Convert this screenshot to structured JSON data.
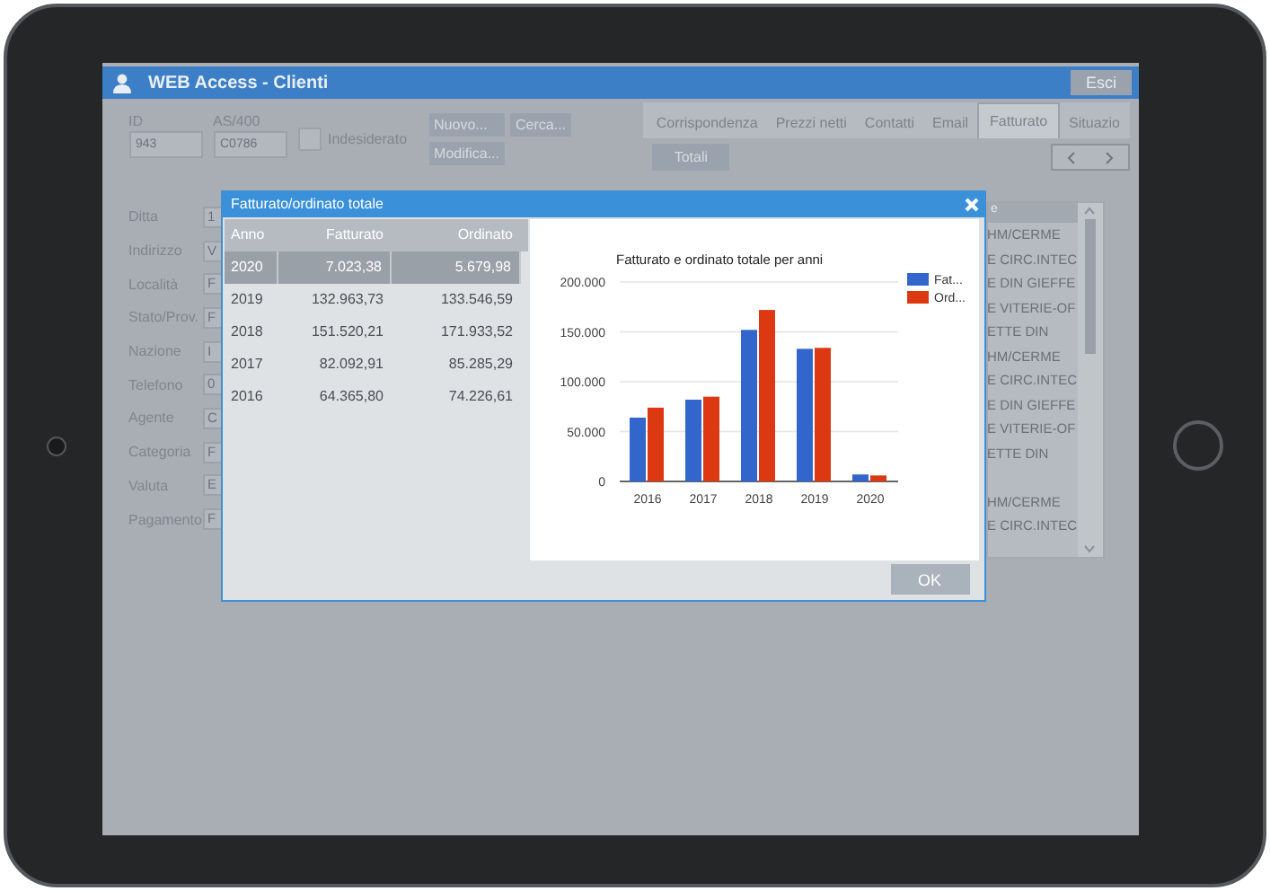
{
  "window": {
    "title": "WEB Access - Clienti",
    "exit_button": "Esci"
  },
  "header_fields": [
    {
      "label": "ID",
      "value": "943"
    },
    {
      "label": "AS/400",
      "value": "C0786"
    }
  ],
  "undesired_checkbox": {
    "label": "Indesiderato",
    "checked": false
  },
  "action_buttons": [
    "Nuovo...",
    "Cerca...",
    "Modifica..."
  ],
  "tabs": [
    {
      "label": "Corrispondenza",
      "selected": false
    },
    {
      "label": "Prezzi netti",
      "selected": false
    },
    {
      "label": "Contatti",
      "selected": false
    },
    {
      "label": "Email",
      "selected": false
    },
    {
      "label": "Fatturato",
      "selected": true
    },
    {
      "label": "Situazio",
      "selected": false
    }
  ],
  "totals_button": "Totali",
  "form_fields": [
    {
      "label": "Ditta",
      "value": "1"
    },
    {
      "label": "Indirizzo",
      "value": "V"
    },
    {
      "label": "Località",
      "value": "F"
    },
    {
      "label": "Stato/Prov.",
      "value": "F"
    },
    {
      "label": "Nazione",
      "value": "I"
    },
    {
      "label": "Telefono",
      "value": "0"
    },
    {
      "label": "Agente",
      "value": "C"
    },
    {
      "label": "Categoria",
      "value": "F"
    },
    {
      "label": "Valuta",
      "value": "E"
    },
    {
      "label": "Pagamento",
      "value": "F"
    }
  ],
  "side_list": {
    "header": "e",
    "row_groups": [
      [
        "HM/CERME",
        "E CIRC.INTEC",
        "E DIN GIEFFE",
        "E VITERIE-OF",
        "ETTE DIN",
        "HM/CERME",
        "E CIRC.INTEC",
        "E DIN GIEFFE",
        "E VITERIE-OF",
        "ETTE DIN"
      ],
      [
        "HM/CERME",
        "E CIRC.INTEC"
      ]
    ]
  },
  "dialog": {
    "title": "Fatturato/ordinato totale",
    "ok_button": "OK",
    "table": {
      "columns": [
        "Anno",
        "Fatturato",
        "Ordinato"
      ],
      "rows": [
        {
          "cells": [
            "2020",
            "7.023,38",
            "5.679,98"
          ],
          "selected": true
        },
        {
          "cells": [
            "2019",
            "132.963,73",
            "133.546,59"
          ],
          "selected": false
        },
        {
          "cells": [
            "2018",
            "151.520,21",
            "171.933,52"
          ],
          "selected": false
        },
        {
          "cells": [
            "2017",
            "82.092,91",
            "85.285,29"
          ],
          "selected": false
        },
        {
          "cells": [
            "2016",
            "64.365,80",
            "74.226,61"
          ],
          "selected": false
        }
      ]
    },
    "chart_data": {
      "type": "bar",
      "title": "Fatturato e ordinato totale per anni",
      "categories": [
        "2016",
        "2017",
        "2018",
        "2019",
        "2020"
      ],
      "series": [
        {
          "name": "Fat...",
          "color": "#3366cc",
          "values": [
            64000,
            82000,
            152000,
            133000,
            7000
          ]
        },
        {
          "name": "Ord...",
          "color": "#dc3912",
          "values": [
            74000,
            85000,
            172000,
            134000,
            6000
          ]
        }
      ],
      "grid": true,
      "legend": true,
      "ylim": [
        0,
        200000
      ],
      "yticks": [
        {
          "value": 0,
          "label": "0"
        },
        {
          "value": 50000,
          "label": "50.000"
        },
        {
          "value": 100000,
          "label": "100.000"
        },
        {
          "value": 150000,
          "label": "150.000"
        },
        {
          "value": 200000,
          "label": "200.000"
        }
      ]
    }
  }
}
